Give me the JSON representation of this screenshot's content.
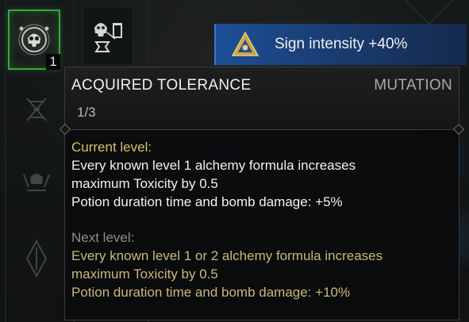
{
  "slots": [
    {
      "name": "mutation-acquired-tolerance",
      "icon": "skull-emblem-icon",
      "badge": "1",
      "active": true
    },
    {
      "name": "mutation-second",
      "icon": "skull-potion-icon",
      "active": false
    }
  ],
  "buff": {
    "icon": "sign-triangle-icon",
    "text": "Sign intensity +40%"
  },
  "tooltip": {
    "title": "ACQUIRED TOLERANCE",
    "type": "MUTATION",
    "rank": "1/3",
    "current": {
      "label": "Current level:",
      "lines": [
        "Every known level 1 alchemy formula increases",
        "maximum Toxicity by 0.5",
        "Potion duration time and bomb damage: +5%"
      ]
    },
    "next": {
      "label": "Next level:",
      "lines": [
        "Every known level 1 or 2 alchemy formula increases",
        "maximum Toxicity by 0.5",
        "Potion duration time and bomb damage: +10%"
      ]
    }
  },
  "colors": {
    "active_border": "#3aa43a",
    "buff_blue": "#1c4f95",
    "current_label": "#d6c16a",
    "next_text": "#c9b87a"
  }
}
